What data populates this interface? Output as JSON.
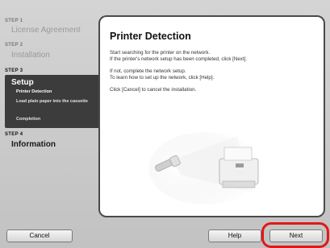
{
  "sidebar": {
    "step1_label": "STEP 1",
    "step1_title": "License Agreement",
    "step2_label": "STEP 2",
    "step2_title": "Installation",
    "step3_label": "STEP 3",
    "step3_title": "Setup",
    "substeps": [
      "Printer Detection",
      "Load plain paper into the cassette",
      "Completion"
    ],
    "step4_label": "STEP 4",
    "step4_title": "Information"
  },
  "panel": {
    "title": "Printer Detection",
    "line1": "Start searching for the printer on the network.",
    "line2": "If the printer's network setup has been completed, click [Next].",
    "line3": "If not, complete the network setup.",
    "line4": "To learn how to set up the network, click [Help].",
    "line5": "Click [Cancel] to cancel the installation."
  },
  "buttons": {
    "cancel": "Cancel",
    "help": "Help",
    "next": "Next"
  },
  "colors": {
    "highlight": "#e01818",
    "sidebar_active": "#3c3c3c"
  }
}
